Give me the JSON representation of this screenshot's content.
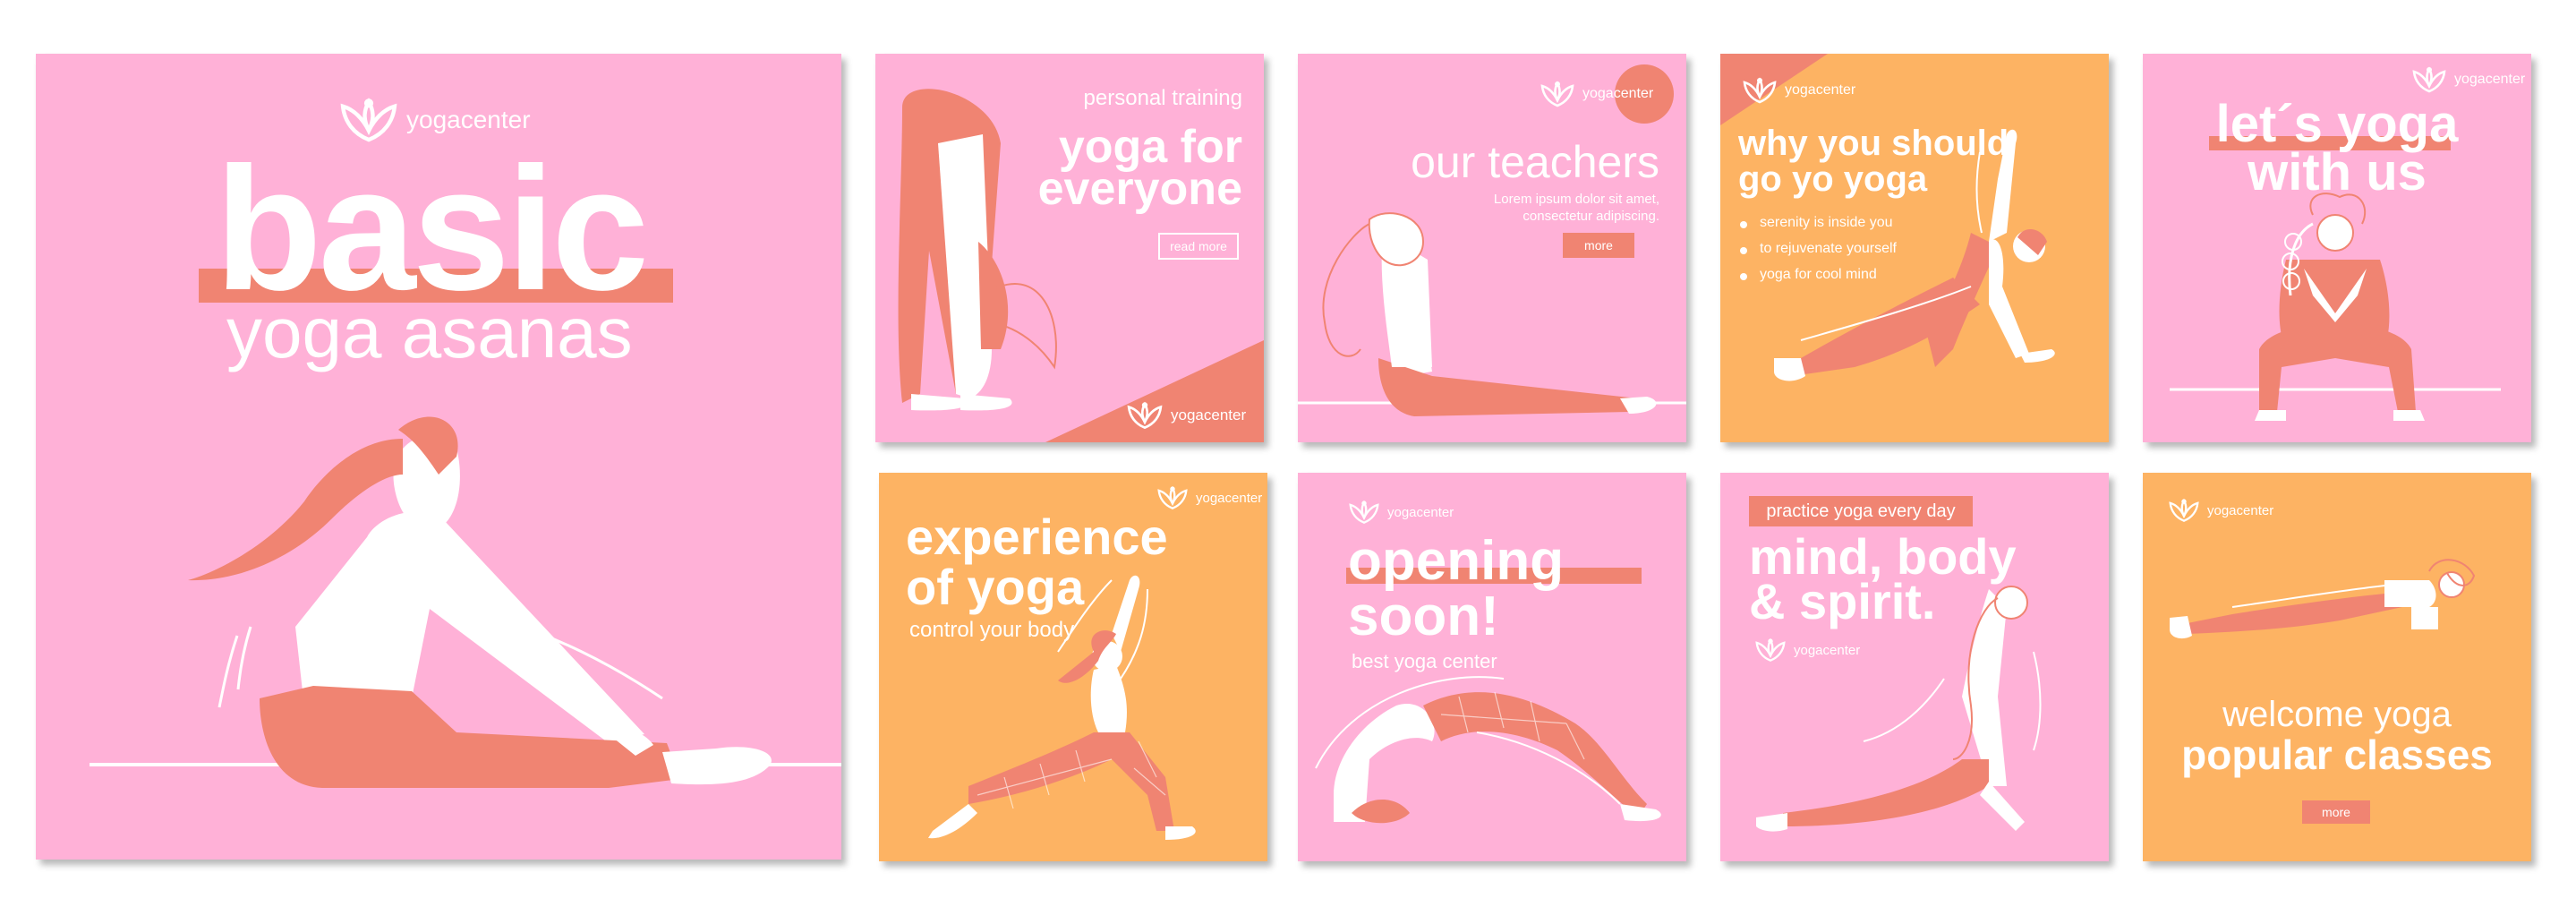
{
  "brand": {
    "logo_text": "yogacenter"
  },
  "colors": {
    "pink": "#ffb1d7",
    "orange": "#fdb363",
    "coral": "#f08472",
    "white": "#ffffff"
  },
  "cards": {
    "basic": {
      "title": "basic",
      "subtitle": "yoga asanas"
    },
    "everyone": {
      "kicker": "personal training",
      "title_1": "yoga for",
      "title_2": "everyone",
      "button": "read more"
    },
    "teachers": {
      "title": "our teachers",
      "text_1": "Lorem ipsum dolor sit amet,",
      "text_2": "consectetur adipiscing.",
      "button": "more"
    },
    "why": {
      "title_1": "why you should",
      "title_2": "go yo yoga",
      "bullets": [
        "serenity is inside you",
        "to rejuvenate yourself",
        "yoga for cool mind"
      ]
    },
    "letsyoga": {
      "title_1": "let´s yoga",
      "title_2": "with us"
    },
    "experience": {
      "title_1": "experience",
      "title_2": "of yoga",
      "subtitle": "control your body"
    },
    "opening": {
      "title_1": "opening",
      "title_2": "soon!",
      "subtitle": "best yoga center"
    },
    "mind": {
      "kicker": "practice yoga every day",
      "title_1": "mind, body",
      "title_2": "& spirit."
    },
    "welcome": {
      "title_1": "welcome yoga",
      "title_2": "popular classes",
      "button": "more"
    }
  }
}
